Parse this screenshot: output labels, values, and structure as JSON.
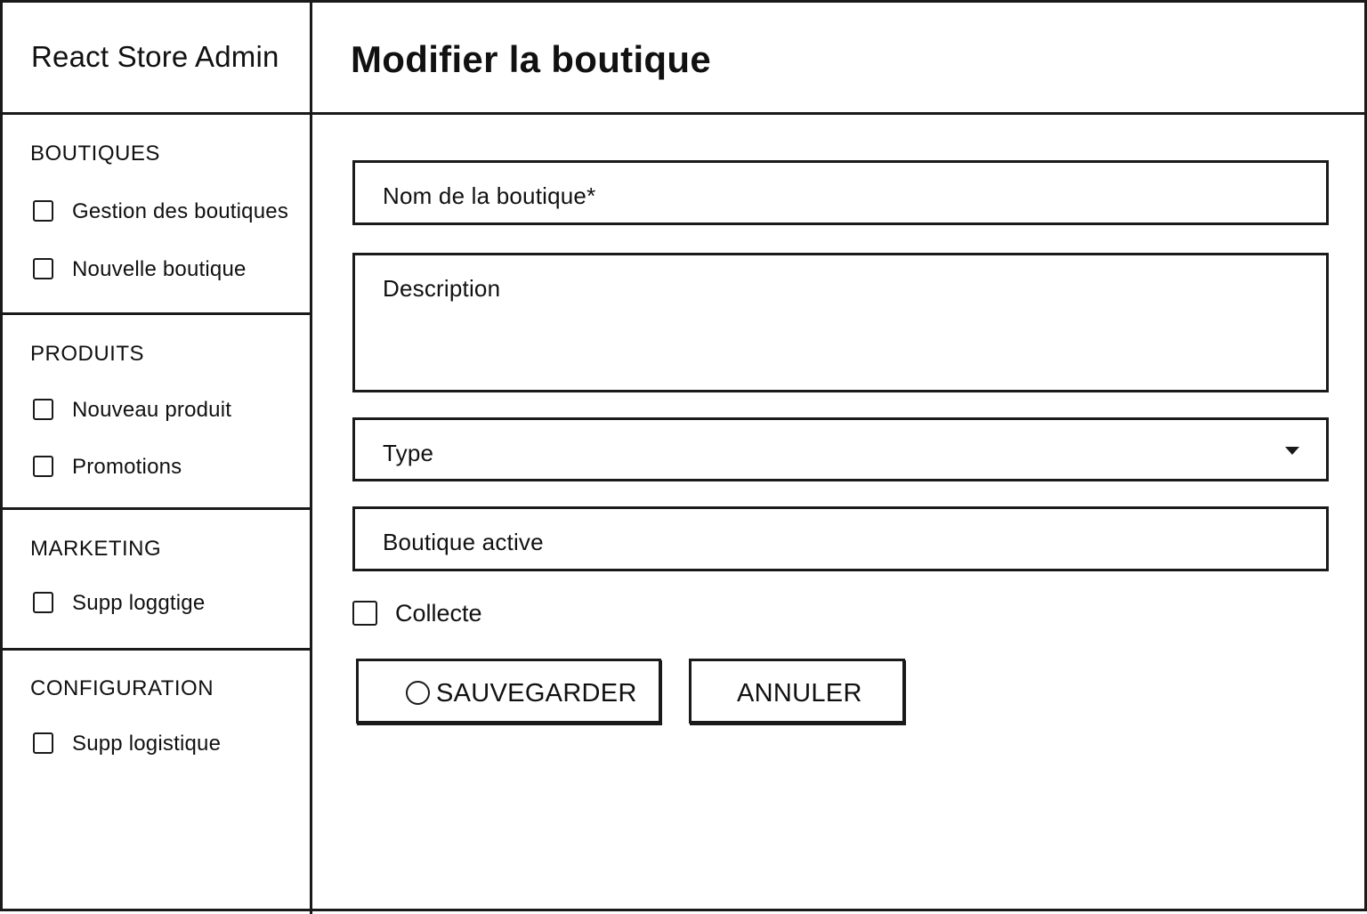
{
  "app": {
    "title": "React Store Admin"
  },
  "sidebar": {
    "sections": [
      {
        "title": "BOUTIQUES",
        "items": [
          {
            "label": "Gestion des boutiques",
            "icon": "checkbox-icon"
          },
          {
            "label": "Nouvelle boutique",
            "icon": "checkbox-icon"
          }
        ]
      },
      {
        "title": "PRODUITS",
        "items": [
          {
            "label": "Nouveau produit",
            "icon": "checkbox-icon"
          },
          {
            "label": "Promotions",
            "icon": "checkbox-icon"
          }
        ]
      },
      {
        "title": "MARKETING",
        "items": [
          {
            "label": "Supp loggtige",
            "icon": "checkbox-icon"
          }
        ]
      },
      {
        "title": "CONFIGURATION",
        "items": [
          {
            "label": "Supp logistique",
            "icon": "checkbox-icon"
          }
        ]
      }
    ]
  },
  "main": {
    "page_title": "Modifier la boutique",
    "form": {
      "name_field": {
        "placeholder": "Nom de la boutique*",
        "value": ""
      },
      "description_field": {
        "placeholder": "Description",
        "value": ""
      },
      "type_select": {
        "label": "Type",
        "icon": "chevron-down-icon"
      },
      "active_field": {
        "label": "Boutique active"
      },
      "collecte_checkbox": {
        "label": "Collecte",
        "checked": false
      }
    },
    "actions": {
      "save_label": "SAUVEGARDER",
      "save_icon": "circle-icon",
      "cancel_label": "ANNULER"
    }
  }
}
